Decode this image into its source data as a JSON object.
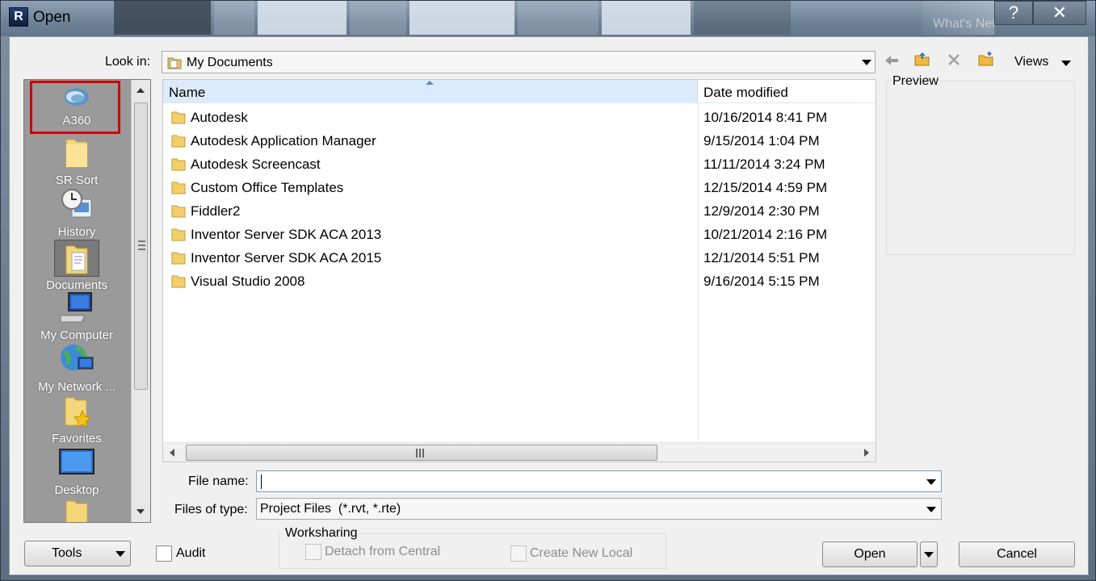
{
  "window": {
    "title": "Open",
    "help_label": "?",
    "close_label": "✕",
    "bg_faded_text": "What's New?"
  },
  "lookin": {
    "label": "Look in:",
    "value": "My Documents"
  },
  "toolbar": {
    "back_icon": "back-arrow-icon",
    "up_icon": "up-folder-icon",
    "delete_icon": "delete-icon",
    "new_folder_icon": "new-folder-icon",
    "views_label": "Views"
  },
  "places": [
    {
      "label": "A360",
      "icon": "a360-icon"
    },
    {
      "label": "SR Sort",
      "icon": "folder-icon"
    },
    {
      "label": "History",
      "icon": "history-icon"
    },
    {
      "label": "Documents",
      "icon": "documents-icon"
    },
    {
      "label": "My Computer",
      "icon": "computer-icon"
    },
    {
      "label": "My Network ...",
      "icon": "network-icon"
    },
    {
      "label": "Favorites",
      "icon": "favorites-icon"
    },
    {
      "label": "Desktop",
      "icon": "desktop-icon"
    }
  ],
  "filelist": {
    "col_name": "Name",
    "col_date": "Date modified",
    "rows": [
      {
        "name": "Autodesk",
        "date": "10/16/2014 8:41 PM"
      },
      {
        "name": "Autodesk Application Manager",
        "date": "9/15/2014 1:04 PM"
      },
      {
        "name": "Autodesk Screencast",
        "date": "11/11/2014 3:24 PM"
      },
      {
        "name": "Custom Office Templates",
        "date": "12/15/2014 4:59 PM"
      },
      {
        "name": "Fiddler2",
        "date": "12/9/2014 2:30 PM"
      },
      {
        "name": "Inventor Server SDK ACA 2013",
        "date": "10/21/2014 2:16 PM"
      },
      {
        "name": "Inventor Server SDK ACA 2015",
        "date": "12/1/2014 5:51 PM"
      },
      {
        "name": "Visual Studio 2008",
        "date": "9/16/2014 5:15 PM"
      }
    ]
  },
  "preview": {
    "label": "Preview"
  },
  "filename": {
    "label": "File name:",
    "value": ""
  },
  "filetype": {
    "label": "Files of type:",
    "value": "Project Files  (*.rvt, *.rte)"
  },
  "bottom": {
    "tools_label": "Tools",
    "audit_label": "Audit",
    "worksharing_label": "Worksharing",
    "detach_label": "Detach from Central",
    "create_local_label": "Create New Local",
    "open_label": "Open",
    "cancel_label": "Cancel"
  },
  "colors": {
    "highlight_box": "#d10000",
    "header_selected": "#dcebfc",
    "folder": "#f3cf6b"
  }
}
